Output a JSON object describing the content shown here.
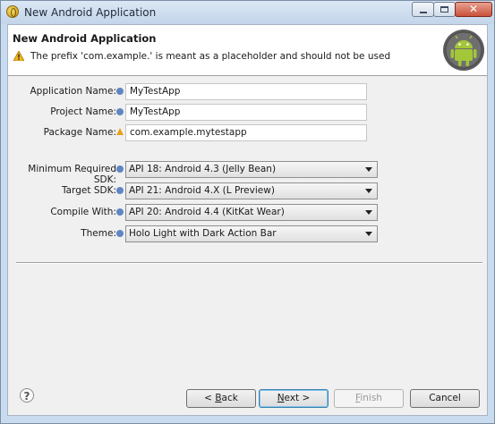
{
  "window": {
    "title": "New Android Application"
  },
  "banner": {
    "title": "New Android Application",
    "message": "The prefix 'com.example.' is meant as a placeholder and should not be used"
  },
  "fields": {
    "app_name": {
      "label": "Application Name:",
      "value": "MyTestApp"
    },
    "project_name": {
      "label": "Project Name:",
      "value": "MyTestApp"
    },
    "package_name": {
      "label": "Package Name:",
      "value": "com.example.mytestapp"
    }
  },
  "selects": {
    "min_sdk": {
      "label": "Minimum Required SDK:",
      "value": "API 18: Android 4.3 (Jelly Bean)"
    },
    "target_sdk": {
      "label": "Target SDK:",
      "value": "API 21: Android 4.X (L Preview)"
    },
    "compile_with": {
      "label": "Compile With:",
      "value": "API 20: Android 4.4 (KitKat Wear)"
    },
    "theme": {
      "label": "Theme:",
      "value": "Holo Light with Dark Action Bar"
    }
  },
  "buttons": {
    "back_mn": "B",
    "back_rest": "ack",
    "back_prefix": "< ",
    "next_mn": "N",
    "next_rest": "ext >",
    "finish_mn": "F",
    "finish_rest": "inish",
    "cancel": "Cancel",
    "help": "?"
  },
  "colors": {
    "logo_green": "#a4c639",
    "info": "#5f86c2",
    "warning": "#e5a21a"
  }
}
